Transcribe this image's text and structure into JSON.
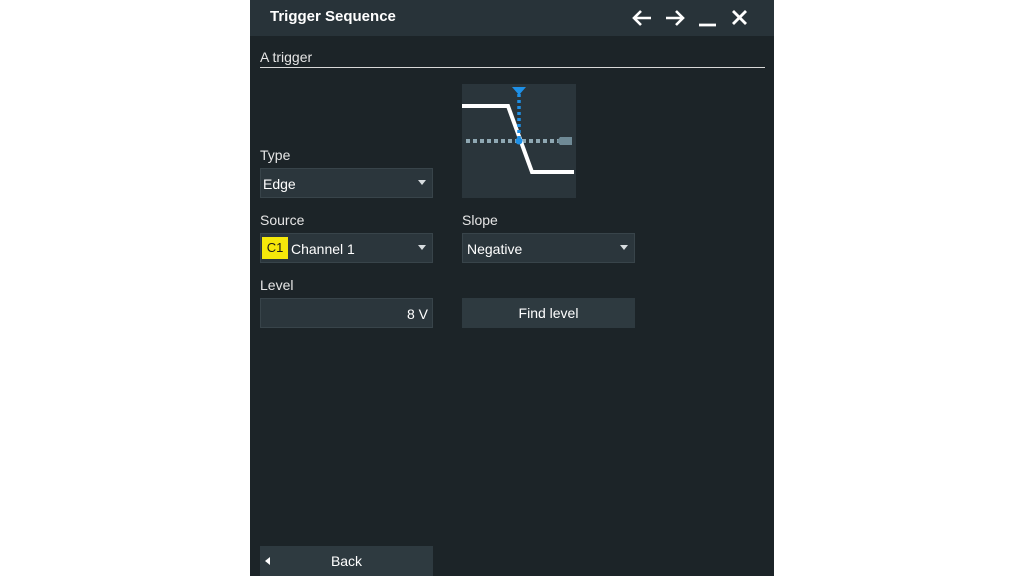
{
  "window": {
    "title": "Trigger Sequence"
  },
  "titlebar_icons": [
    "arrow-left-icon",
    "arrow-right-icon",
    "minimize-icon",
    "close-icon"
  ],
  "section": {
    "label": "A trigger"
  },
  "type": {
    "label": "Type",
    "value": "Edge"
  },
  "source": {
    "label": "Source",
    "badge": "C1",
    "value": "Channel 1"
  },
  "slope": {
    "label": "Slope",
    "value": "Negative"
  },
  "level": {
    "label": "Level",
    "value": "8 V"
  },
  "buttons": {
    "find_level": "Find level",
    "back": "Back"
  },
  "colors": {
    "dialog_bg": "#1c2428",
    "titlebar_bg": "#283339",
    "channel1": "#f5e80a",
    "trigger_marker": "#1e90e6"
  }
}
